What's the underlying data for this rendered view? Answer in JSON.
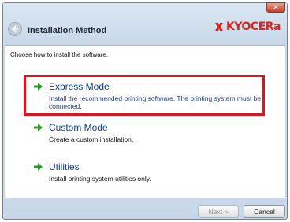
{
  "window": {
    "title": "Installation Method",
    "close_label": "✕"
  },
  "brand": {
    "name": "KYOCERa",
    "color": "#d8261f"
  },
  "content": {
    "instruction": "Choose how to install the software.",
    "options": [
      {
        "title": "Express Mode",
        "description": "Install the recommended printing software. The printing system must be connected.",
        "highlighted": true
      },
      {
        "title": "Custom Mode",
        "description": "Create a custom installation."
      },
      {
        "title": "Utilities",
        "description": "Install printing system utilities only."
      }
    ]
  },
  "buttons": {
    "next": "Next >",
    "next_enabled": false,
    "cancel": "Cancel"
  },
  "colors": {
    "highlight_border": "#e0141e",
    "option_arrow": "#2f9a2a",
    "option_title": "#0a3c8a"
  }
}
